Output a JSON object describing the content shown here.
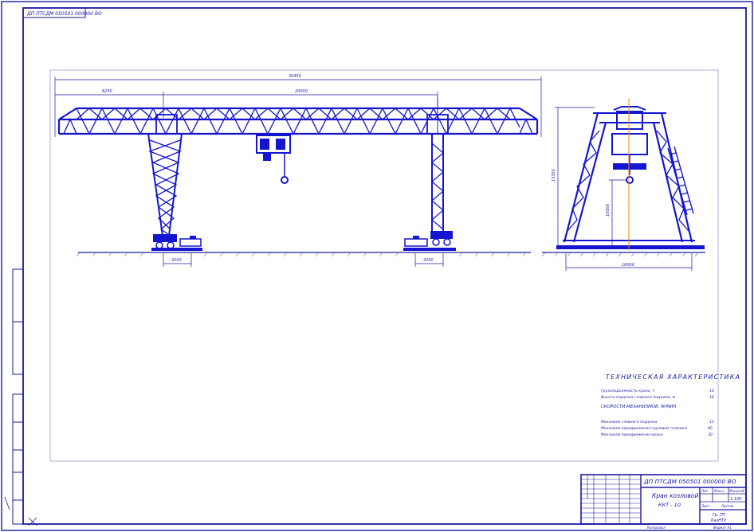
{
  "drawing": {
    "code_top": "ДП ПТСДМ 050501 000000 ВО",
    "code_stamp": "ДП ПТСДМ 050501 000000 ВО"
  },
  "tech_char": {
    "title": "ТЕХНИЧЕСКАЯ ХАРАКТЕРИСТИКА",
    "rows": [
      {
        "label": "Грузоподъемность крана, т",
        "value": "10"
      },
      {
        "label": "Высота подъема главного подъема, м",
        "value": "10"
      },
      {
        "label": "СКОРОСТИ МЕХАНИЗМОВ, М/МИН",
        "value": ""
      },
      {
        "label": "Механизм главного подъема",
        "value": "15"
      },
      {
        "label": "Механизм передвижения грузовой тележки",
        "value": "40"
      },
      {
        "label": "Механизм передвижения крана",
        "value": "30"
      }
    ]
  },
  "dimensions": {
    "overall_length": "30450",
    "left_cantilever": "6250",
    "span": "20000",
    "left_base": "3200",
    "right_base": "3200",
    "side_height": "15350",
    "side_lift": "10000",
    "side_width": "16000"
  },
  "title_block": {
    "name_line1": "Кран козловой",
    "name_line2": "ККТ - 10",
    "lit_header": "Лит.",
    "mass_header": "Масса",
    "scale_header": "Масштаб",
    "scale_value": "1:100",
    "sheet_label": "Лист",
    "sheets_label": "Листов",
    "org_line1": "Гр. ПТ",
    "org_line2": "КазНТУ",
    "copied": "Копировал",
    "format": "Формат А1"
  },
  "colors": {
    "ink": "#1a1aa0",
    "structure": "#1414d2",
    "axis": "#e08a00"
  }
}
